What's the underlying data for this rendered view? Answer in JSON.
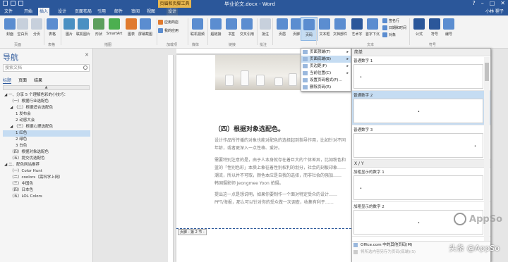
{
  "titlebar": {
    "context_tool": "页眉和页脚工具",
    "document_title": "毕业论文.docx - Word",
    "window_controls": [
      "?",
      "–",
      "□",
      "✕"
    ],
    "user": "小林 猩子"
  },
  "tabs": [
    "文件",
    "开始",
    "插入",
    "设计",
    "页面布局",
    "引用",
    "邮件",
    "审阅",
    "视图",
    "设计"
  ],
  "ribbon": {
    "buttons": [
      {
        "label": "封面",
        "color": "#5b8dd0"
      },
      {
        "label": "空白页",
        "color": "#9aa8ba"
      },
      {
        "label": "分页",
        "color": "#9aa8ba"
      },
      {
        "label": "表格",
        "color": "#5b8dd0"
      },
      {
        "label": "图片",
        "color": "#4a90c2"
      },
      {
        "label": "联机图片",
        "color": "#4a90c2"
      },
      {
        "label": "形状",
        "color": "#5c9f5c"
      },
      {
        "label": "SmartArt",
        "color": "#4caf50"
      },
      {
        "label": "图表",
        "color": "#e07a2e"
      },
      {
        "label": "屏幕截图",
        "color": "#5b8dd0"
      },
      {
        "label": "联机视频",
        "color": "#5b8dd0"
      },
      {
        "label": "超链接",
        "color": "#5b8dd0"
      },
      {
        "label": "书签",
        "color": "#5b8dd0"
      },
      {
        "label": "交叉引用",
        "color": "#5b8dd0"
      },
      {
        "label": "批注",
        "color": "#9aa8ba"
      },
      {
        "label": "页眉",
        "color": "#5b8dd0"
      },
      {
        "label": "页脚",
        "color": "#5b8dd0"
      },
      {
        "label": "页码",
        "color": "#5b8dd0"
      },
      {
        "label": "文本框",
        "color": "#5b8dd0"
      },
      {
        "label": "文档部件",
        "color": "#5b8dd0"
      },
      {
        "label": "艺术字",
        "color": "#2b579a"
      },
      {
        "label": "首字下沉",
        "color": "#5b8dd0"
      },
      {
        "label": "公式",
        "color": "#2b579a"
      },
      {
        "label": "符号",
        "color": "#2b579a"
      },
      {
        "label": "编号",
        "color": "#5b8dd0"
      }
    ],
    "small_items": {
      "store": "应用商店",
      "my_apps": "我的应用",
      "signature": "签名行",
      "datetime": "日期和时间",
      "object": "对象"
    },
    "groups": [
      "页面",
      "表格",
      "插图",
      "加载项",
      "媒体",
      "链接",
      "批注",
      "",
      "文本",
      "符号"
    ]
  },
  "navigation": {
    "title": "导航",
    "close": "✕",
    "search_placeholder": "搜索文档",
    "tabs": [
      "标题",
      "页面",
      "结果"
    ],
    "tree": [
      {
        "label": "◢ 一、分享 5 个理解色彩的小技巧：",
        "indent": 0,
        "selected": false
      },
      {
        "label": "（一）根据行业选配色",
        "indent": 1,
        "selected": false
      },
      {
        "label": "◢ （二）根据适合选配色",
        "indent": 1,
        "selected": false
      },
      {
        "label": "1 发布会",
        "indent": 2,
        "selected": false
      },
      {
        "label": "2 动感大会",
        "indent": 2,
        "selected": false
      },
      {
        "label": "◢ （三）根据心理选配色",
        "indent": 1,
        "selected": false
      },
      {
        "label": "1 红色",
        "indent": 2,
        "selected": true
      },
      {
        "label": "2 绿色",
        "indent": 2,
        "selected": false
      },
      {
        "label": "3 白色",
        "indent": 2,
        "selected": false
      },
      {
        "label": "（四）根据对象选配色",
        "indent": 1,
        "selected": false
      },
      {
        "label": "（五）提交优选配色",
        "indent": 1,
        "selected": false
      },
      {
        "label": "◢ 二、配色网站推荐",
        "indent": 0,
        "selected": false
      },
      {
        "label": "（一）Color Hunt",
        "indent": 1,
        "selected": false
      },
      {
        "label": "（二）coolors（需科学上网）",
        "indent": 1,
        "selected": false
      },
      {
        "label": "（三）中国色",
        "indent": 1,
        "selected": false
      },
      {
        "label": "（四）日本色",
        "indent": 1,
        "selected": false
      },
      {
        "label": "（五）LOL Colors",
        "indent": 1,
        "selected": false
      }
    ]
  },
  "document": {
    "heading": "（四）根据对象选配色。",
    "paragraphs": [
      "设计作品所传播的对象也能对配色的选择起到指导作用，比如针对不同",
      "年龄，或者更深入一点性格、爱好。",
      "需要特别注意的是，由于人本身就存在着巨大的个体差异，比如粉色和",
      "蓝的「性别色彩」本质上象征着性别权利的划分，社会的刻板印象……",
      "潮流，所以并不可取，颜色本应是自我的选择，而非社会的强加……",
      "韩国摄影师 Jeongmee Yoon 拍摄。",
      "提出这一点是想说明，如果你要制作一个面对特定受众的设计……",
      "PPT/海报，那么可以针对你的受众做一次调查，收集有利于……"
    ],
    "footer_tag": "页脚 - 第 2 节 -"
  },
  "page_number_menu": {
    "items": [
      {
        "label": "页面顶端(T)",
        "has_sub": true,
        "highlighted": false
      },
      {
        "label": "页面底端(B)",
        "has_sub": true,
        "highlighted": true
      },
      {
        "label": "页边距(P)",
        "has_sub": true,
        "highlighted": false
      },
      {
        "label": "当前位置(C)",
        "has_sub": true,
        "highlighted": false
      },
      {
        "label": "设置页码格式(F)...",
        "has_sub": false,
        "highlighted": false
      },
      {
        "label": "删除页码(R)",
        "has_sub": false,
        "highlighted": false
      }
    ]
  },
  "gallery": {
    "section_simple": "简单",
    "items": [
      {
        "label": "普通数字 1",
        "align": "left",
        "highlighted": false
      },
      {
        "label": "普通数字 2",
        "align": "center",
        "highlighted": true
      },
      {
        "label": "普通数字 3",
        "align": "right",
        "highlighted": false
      }
    ],
    "section_xy": "X / Y",
    "xy_items": [
      {
        "label": "加粗显示的数字 1",
        "align": "left",
        "highlighted": false
      },
      {
        "label": "加粗显示的数字 2",
        "align": "center",
        "highlighted": false
      }
    ],
    "footer_more": "Office.com 中的其他页码(M)",
    "footer_save": "将所选内容另存为页码(底端)(S)"
  },
  "watermark": {
    "brand": "AppSo",
    "caption": "头条 @AppSo"
  }
}
